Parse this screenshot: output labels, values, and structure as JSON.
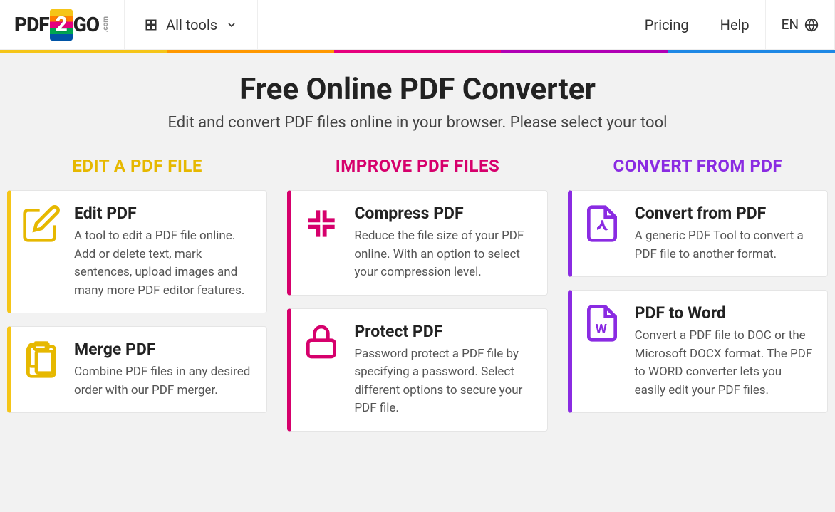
{
  "header": {
    "logo_left": "PDF",
    "logo_mid": "2",
    "logo_right": "GO",
    "logo_suffix": ".com",
    "all_tools": "All tools",
    "nav": {
      "pricing": "Pricing",
      "help": "Help"
    },
    "lang": "EN"
  },
  "rainbow": [
    "#f5c518",
    "#ff9800",
    "#e6007e",
    "#b000b5",
    "#1e88e5"
  ],
  "hero": {
    "title": "Free Online PDF Converter",
    "subtitle": "Edit and convert PDF files online in your browser. Please select your tool"
  },
  "columns": [
    {
      "key": "edit",
      "title": "EDIT A PDF FILE",
      "color": "#e6b800",
      "cards": [
        {
          "icon": "edit",
          "title": "Edit PDF",
          "desc": "A tool to edit a PDF file online. Add or delete text, mark sentences, upload images and many more PDF editor features."
        },
        {
          "icon": "merge",
          "title": "Merge PDF",
          "desc": "Combine PDF files in any desired order with our PDF merger."
        }
      ]
    },
    {
      "key": "improve",
      "title": "IMPROVE PDF FILES",
      "color": "#d6006c",
      "cards": [
        {
          "icon": "compress",
          "title": "Compress PDF",
          "desc": "Reduce the file size of your PDF online. With an option to select your compression level."
        },
        {
          "icon": "protect",
          "title": "Protect PDF",
          "desc": "Password protect a PDF file by specifying a password. Select different options to secure your PDF file."
        }
      ]
    },
    {
      "key": "convert",
      "title": "CONVERT FROM PDF",
      "color": "#8a2be2",
      "cards": [
        {
          "icon": "convert",
          "title": "Convert from PDF",
          "desc": "A generic PDF Tool to convert a PDF file to another format."
        },
        {
          "icon": "word",
          "title": "PDF to Word",
          "desc": "Convert a PDF file to DOC or the Microsoft DOCX format. The PDF to WORD converter lets you easily edit your PDF files."
        }
      ]
    }
  ]
}
